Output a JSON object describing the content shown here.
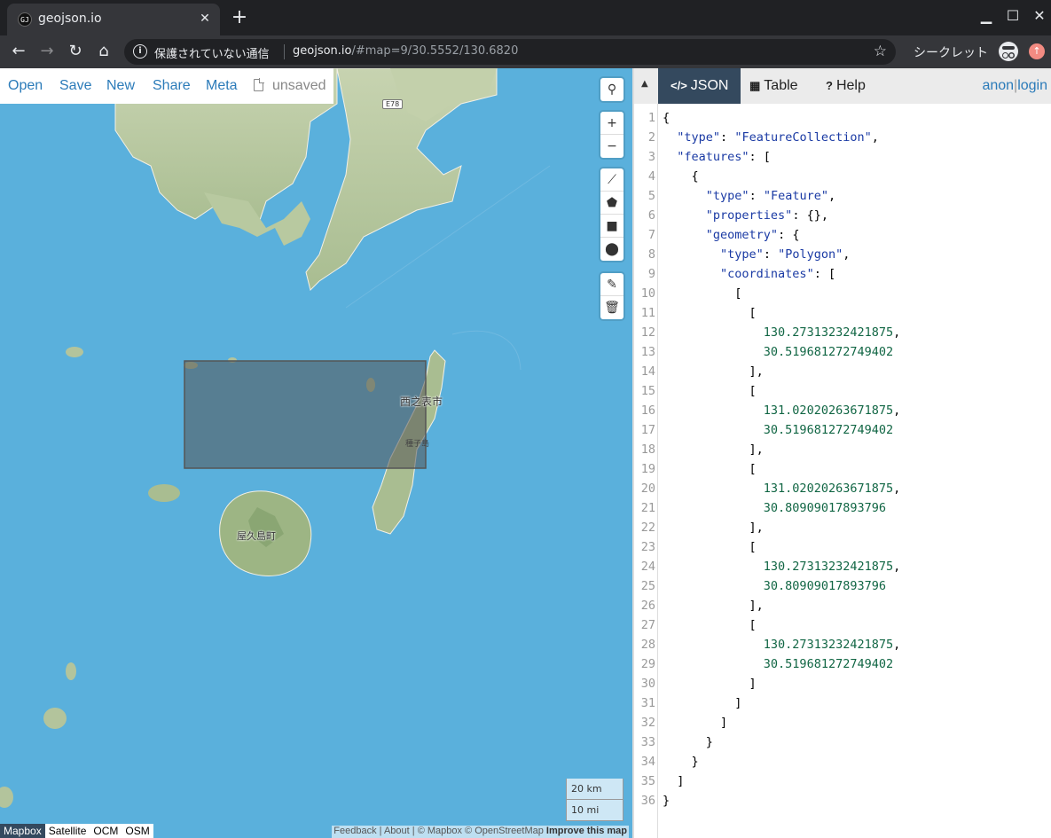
{
  "browser": {
    "tab_title": "geojson.io",
    "tab_favicon_text": "GJ",
    "security_text": "保護されていない通信",
    "url_host": "geojson.io",
    "url_path": "/#map=9/30.5552/130.6820",
    "incognito_label": "シークレット"
  },
  "menu": {
    "open": "Open",
    "save": "Save",
    "new": "New",
    "share": "Share",
    "meta": "Meta",
    "status": "unsaved"
  },
  "map": {
    "labels": {
      "city1": "西之表市",
      "city2": "屋久島町",
      "small1": "種子島",
      "road": "E78"
    },
    "scale": {
      "km": "20 km",
      "mi": "10 mi"
    },
    "basemaps": [
      "Mapbox",
      "Satellite",
      "OCM",
      "OSM"
    ],
    "active_basemap": "Mapbox",
    "attribution": {
      "feedback": "Feedback",
      "about": "About",
      "copyright": "© Mapbox © OpenStreetMap",
      "improve": "Improve this map"
    }
  },
  "pane": {
    "tabs": {
      "json": "JSON",
      "table": "Table",
      "help": "Help"
    },
    "auth": {
      "anon": "anon",
      "sep": "|",
      "login": "login"
    }
  },
  "geojson": {
    "type": "FeatureCollection",
    "feature_type": "Feature",
    "geometry_type": "Polygon",
    "coordinates": [
      [
        "130.27313232421875",
        "30.519681272749402"
      ],
      [
        "131.02020263671875",
        "30.519681272749402"
      ],
      [
        "131.02020263671875",
        "30.80909017893796"
      ],
      [
        "130.27313232421875",
        "30.80909017893796"
      ],
      [
        "130.27313232421875",
        "30.519681272749402"
      ]
    ]
  },
  "code_lines": [
    [
      [
        "p",
        "{"
      ]
    ],
    [
      [
        "p",
        "  "
      ],
      [
        "k",
        "\"type\""
      ],
      [
        "p",
        ": "
      ],
      [
        "s",
        "\"FeatureCollection\""
      ],
      [
        "p",
        ","
      ]
    ],
    [
      [
        "p",
        "  "
      ],
      [
        "k",
        "\"features\""
      ],
      [
        "p",
        ": ["
      ]
    ],
    [
      [
        "p",
        "    {"
      ]
    ],
    [
      [
        "p",
        "      "
      ],
      [
        "k",
        "\"type\""
      ],
      [
        "p",
        ": "
      ],
      [
        "s",
        "\"Feature\""
      ],
      [
        "p",
        ","
      ]
    ],
    [
      [
        "p",
        "      "
      ],
      [
        "k",
        "\"properties\""
      ],
      [
        "p",
        ": {},"
      ]
    ],
    [
      [
        "p",
        "      "
      ],
      [
        "k",
        "\"geometry\""
      ],
      [
        "p",
        ": {"
      ]
    ],
    [
      [
        "p",
        "        "
      ],
      [
        "k",
        "\"type\""
      ],
      [
        "p",
        ": "
      ],
      [
        "s",
        "\"Polygon\""
      ],
      [
        "p",
        ","
      ]
    ],
    [
      [
        "p",
        "        "
      ],
      [
        "k",
        "\"coordinates\""
      ],
      [
        "p",
        ": ["
      ]
    ],
    [
      [
        "p",
        "          ["
      ]
    ],
    [
      [
        "p",
        "            ["
      ]
    ],
    [
      [
        "p",
        "              "
      ],
      [
        "n",
        "130.27313232421875"
      ],
      [
        "p",
        ","
      ]
    ],
    [
      [
        "p",
        "              "
      ],
      [
        "n",
        "30.519681272749402"
      ]
    ],
    [
      [
        "p",
        "            ],"
      ]
    ],
    [
      [
        "p",
        "            ["
      ]
    ],
    [
      [
        "p",
        "              "
      ],
      [
        "n",
        "131.02020263671875"
      ],
      [
        "p",
        ","
      ]
    ],
    [
      [
        "p",
        "              "
      ],
      [
        "n",
        "30.519681272749402"
      ]
    ],
    [
      [
        "p",
        "            ],"
      ]
    ],
    [
      [
        "p",
        "            ["
      ]
    ],
    [
      [
        "p",
        "              "
      ],
      [
        "n",
        "131.02020263671875"
      ],
      [
        "p",
        ","
      ]
    ],
    [
      [
        "p",
        "              "
      ],
      [
        "n",
        "30.80909017893796"
      ]
    ],
    [
      [
        "p",
        "            ],"
      ]
    ],
    [
      [
        "p",
        "            ["
      ]
    ],
    [
      [
        "p",
        "              "
      ],
      [
        "n",
        "130.27313232421875"
      ],
      [
        "p",
        ","
      ]
    ],
    [
      [
        "p",
        "              "
      ],
      [
        "n",
        "30.80909017893796"
      ]
    ],
    [
      [
        "p",
        "            ],"
      ]
    ],
    [
      [
        "p",
        "            ["
      ]
    ],
    [
      [
        "p",
        "              "
      ],
      [
        "n",
        "130.27313232421875"
      ],
      [
        "p",
        ","
      ]
    ],
    [
      [
        "p",
        "              "
      ],
      [
        "n",
        "30.519681272749402"
      ]
    ],
    [
      [
        "p",
        "            ]"
      ]
    ],
    [
      [
        "p",
        "          ]"
      ]
    ],
    [
      [
        "p",
        "        ]"
      ]
    ],
    [
      [
        "p",
        "      }"
      ]
    ],
    [
      [
        "p",
        "    }"
      ]
    ],
    [
      [
        "p",
        "  ]"
      ]
    ],
    [
      [
        "p",
        "}"
      ]
    ]
  ],
  "colors": {
    "accent": "#34495e",
    "link": "#2b7bb9",
    "water": "#5ab0dc",
    "land": "#b9c8a2",
    "polygon_fill": "#555555"
  }
}
